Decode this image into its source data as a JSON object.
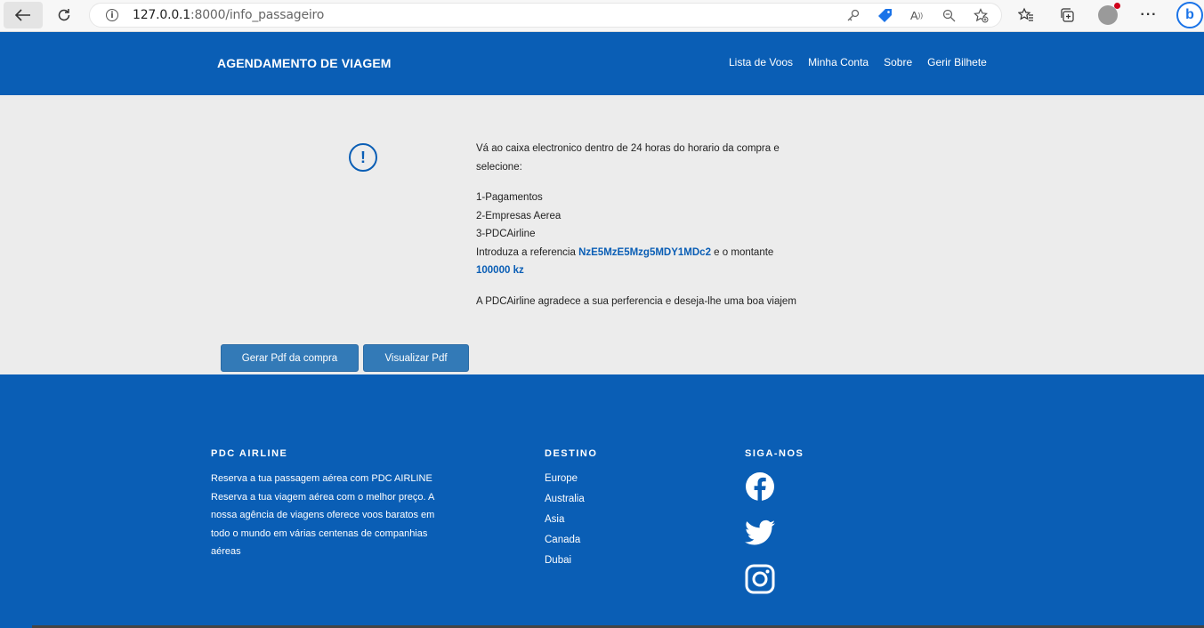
{
  "browser": {
    "url_host": "127.0.0.1",
    "url_path": ":8000/info_passageiro"
  },
  "header": {
    "brand": "AGENDAMENTO DE VIAGEM",
    "nav": [
      "Lista de Voos",
      "Minha Conta",
      "Sobre",
      "Gerir Bilhete"
    ]
  },
  "main": {
    "intro": "Vá ao caixa electronico dentro de 24 horas do horario da compra e selecione:",
    "steps": [
      "1-Pagamentos",
      "2-Empresas Aerea",
      "3-PDCAirline"
    ],
    "ref_prefix": "Introduza a referencia ",
    "reference": "NzE5MzE5Mzg5MDY1MDc2",
    "ref_middle": " e o montante",
    "amount": "100000 kz",
    "thanks": "A PDCAirline agradece a sua perferencia e deseja-lhe uma boa viajem",
    "button_pdf": "Gerar Pdf da compra",
    "button_view": "Visualizar Pdf"
  },
  "footer": {
    "col1_title": "PDC AIRLINE",
    "col1_text": "Reserva a tua passagem aérea com PDC AIRLINE Reserva a tua viagem aérea com o melhor preço. A nossa agência de viagens oferece voos baratos em todo o mundo em várias centenas de companhias aéreas",
    "col2_title": "DESTINO",
    "destinations": [
      "Europe",
      "Australia",
      "Asia",
      "Canada",
      "Dubai"
    ],
    "col3_title": "SIGA-NOS",
    "social_icons": [
      "facebook-icon",
      "twitter-icon",
      "instagram-icon"
    ]
  }
}
